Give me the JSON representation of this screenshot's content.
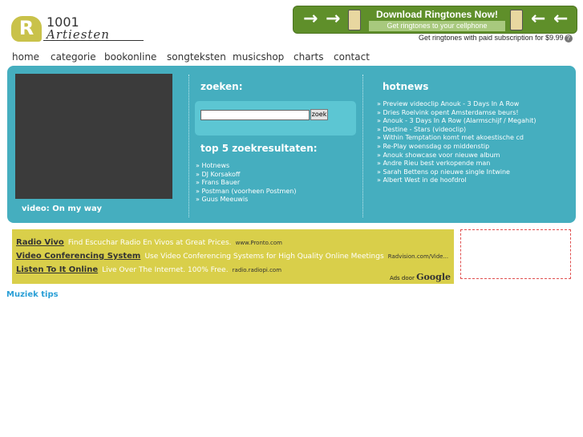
{
  "logo": {
    "number": "1001",
    "name": "Artiesten"
  },
  "banner": {
    "title": "Download Ringtones Now!",
    "subtitle": "Get ringtones to your cellphone",
    "caption": "Get ringtones with paid subscription for $9.99",
    "help": "?"
  },
  "nav": [
    "home",
    "categorie",
    "bookonline",
    "songteksten",
    "musicshop",
    "charts",
    "contact"
  ],
  "video": {
    "label": "video: On my way"
  },
  "search": {
    "heading": "zoeken:",
    "value": "",
    "button": "zoek",
    "top_heading": "top 5 zoekresultaten:",
    "top_results": [
      "Hotnews",
      "DJ Korsakoff",
      "Frans Bauer",
      "Postman (voorheen Postmen)",
      "Guus Meeuwis"
    ]
  },
  "hotnews": {
    "heading": "hotnews",
    "items": [
      "Preview videoclip Anouk - 3 Days In A Row",
      "Dries Roelvink opent Amsterdamse beurs!",
      "Anouk - 3 Days In A Row (Alarmschijf / Megahit)",
      "Destine - Stars (videoclip)",
      "Within Temptation komt met akoestische cd",
      "Re-Play woensdag op middenstip",
      "Anouk showcase voor nieuwe album",
      "Andre Rieu best verkopende man",
      "Sarah Bettens op nieuwe single Intwine",
      "Albert West in de hoofdrol"
    ]
  },
  "ads": {
    "items": [
      {
        "title": "Radio Vivo",
        "text": "Find Escuchar Radio En Vivos at Great Prices.",
        "url": "www.Pronto.com"
      },
      {
        "title": "Video Conferencing System",
        "text": "Use Video Conferencing Systems for High Quality Online Meetings",
        "url": "Radvision.com/Vide..."
      },
      {
        "title": "Listen To It Online",
        "text": "Live Over The Internet. 100% Free.",
        "url": "radio.radiopi.com"
      }
    ],
    "by_label": "Ads door",
    "by_brand": "Google"
  },
  "tips": {
    "heading": "Muziek tips"
  },
  "colors": {
    "teal": "#45aebf",
    "ad_yellow": "#d9cf4a",
    "tips_blue": "#2a9fd6",
    "banner_green": "#5f8f2a"
  }
}
